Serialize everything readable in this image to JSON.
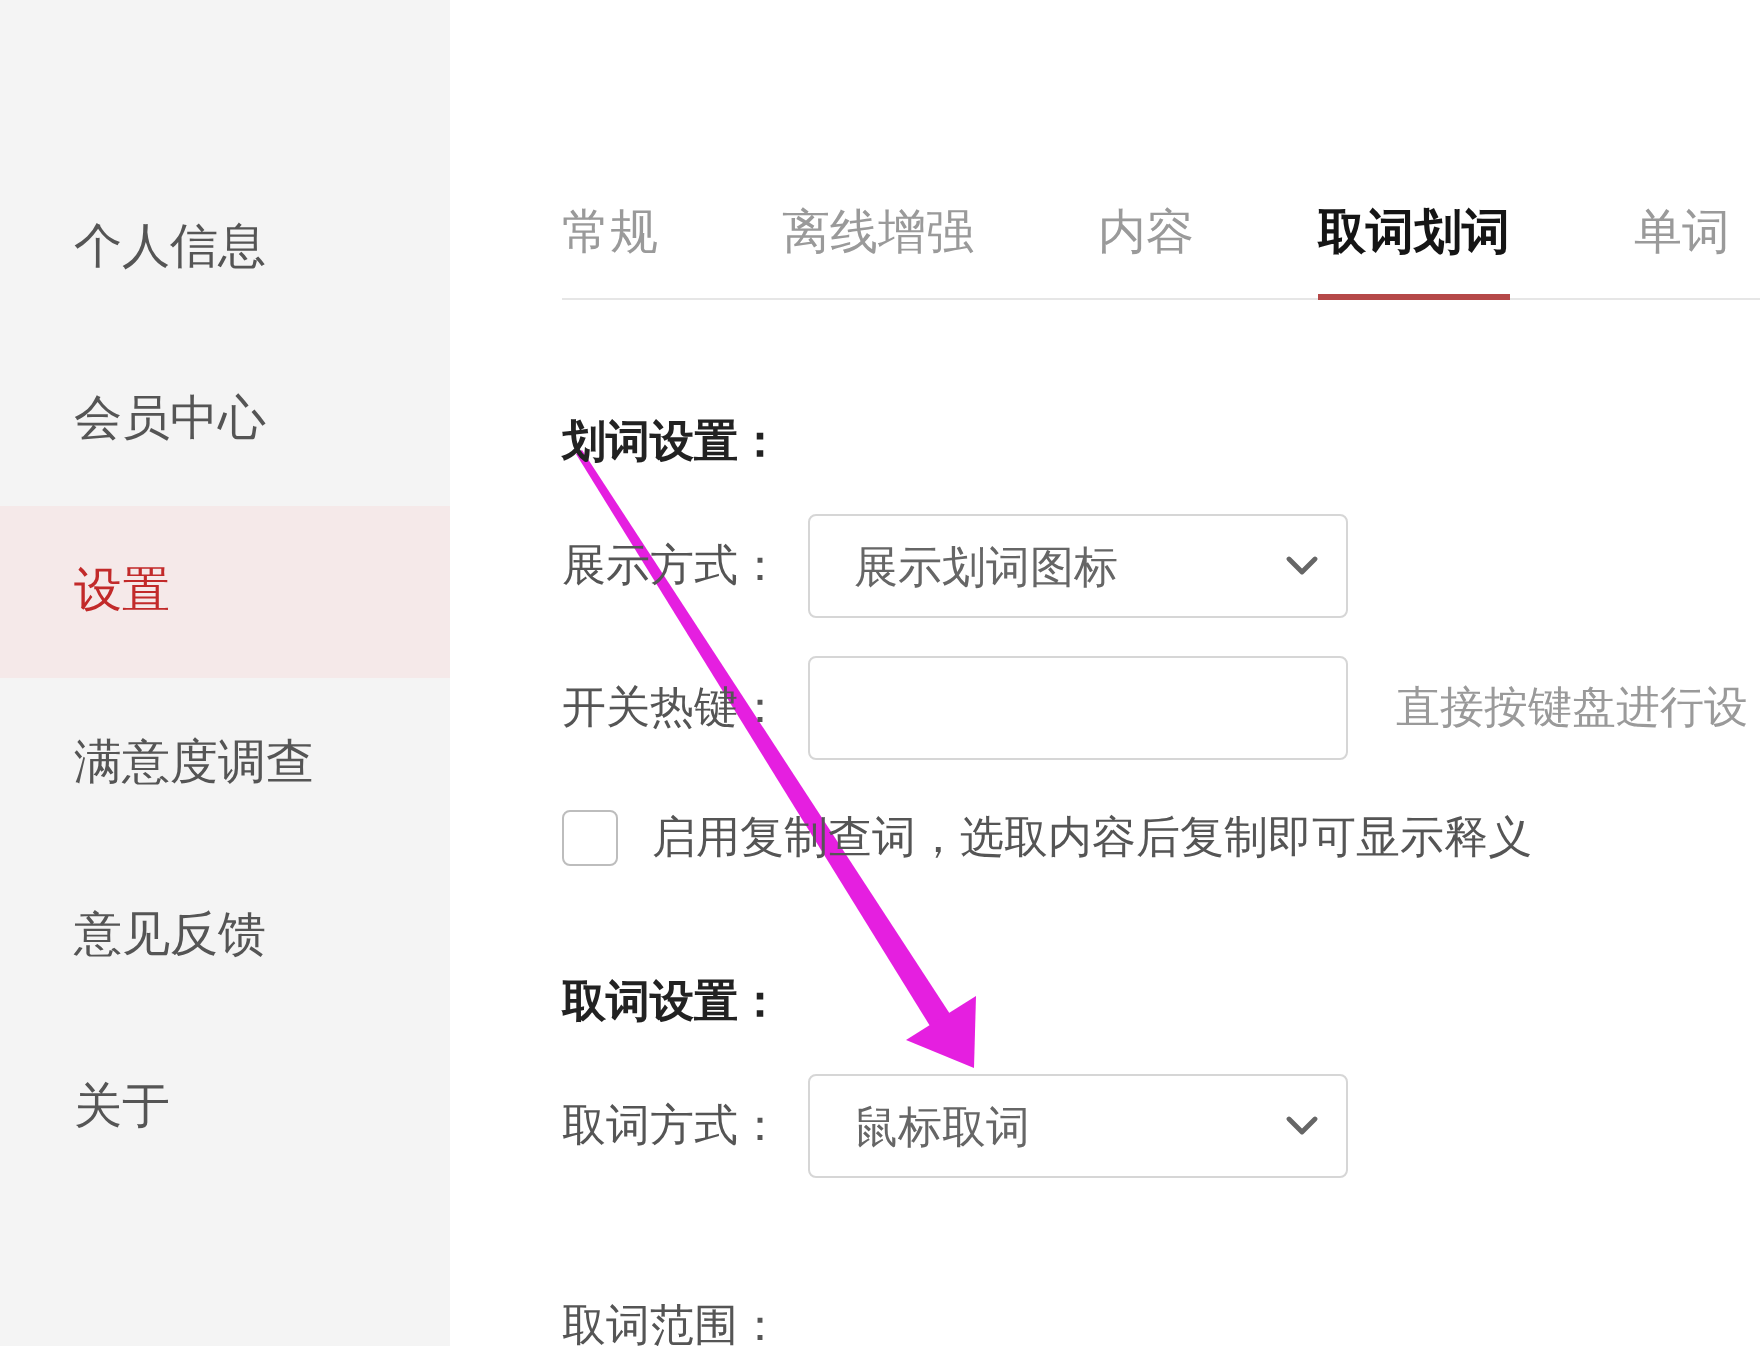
{
  "sidebar": {
    "items": [
      {
        "label": "个人信息",
        "selected": false
      },
      {
        "label": "会员中心",
        "selected": false
      },
      {
        "label": "设置",
        "selected": true
      },
      {
        "label": "满意度调查",
        "selected": false
      },
      {
        "label": "意见反馈",
        "selected": false
      },
      {
        "label": "关于",
        "selected": false
      }
    ]
  },
  "tabs": [
    {
      "label": "常规",
      "selected": false
    },
    {
      "label": "离线增强",
      "selected": false
    },
    {
      "label": "内容",
      "selected": false
    },
    {
      "label": "取词划词",
      "selected": true
    },
    {
      "label": "单词",
      "selected": false
    }
  ],
  "sections": [
    {
      "title": "划词设置：",
      "rows": [
        {
          "kind": "select",
          "label": "展示方式：",
          "value": "展示划词图标"
        },
        {
          "kind": "input",
          "label": "开关热键：",
          "note": "直接按键盘进行设"
        },
        {
          "kind": "checkbox",
          "label": "启用复制查词，选取内容后复制即可显示释义",
          "checked": false
        }
      ]
    },
    {
      "title": "取词设置：",
      "rows": [
        {
          "kind": "select",
          "label": "取词方式：",
          "value": "鼠标取词"
        },
        {
          "kind": "label",
          "label": "取词范围："
        }
      ]
    }
  ],
  "annotation": {
    "kind": "arrow"
  }
}
